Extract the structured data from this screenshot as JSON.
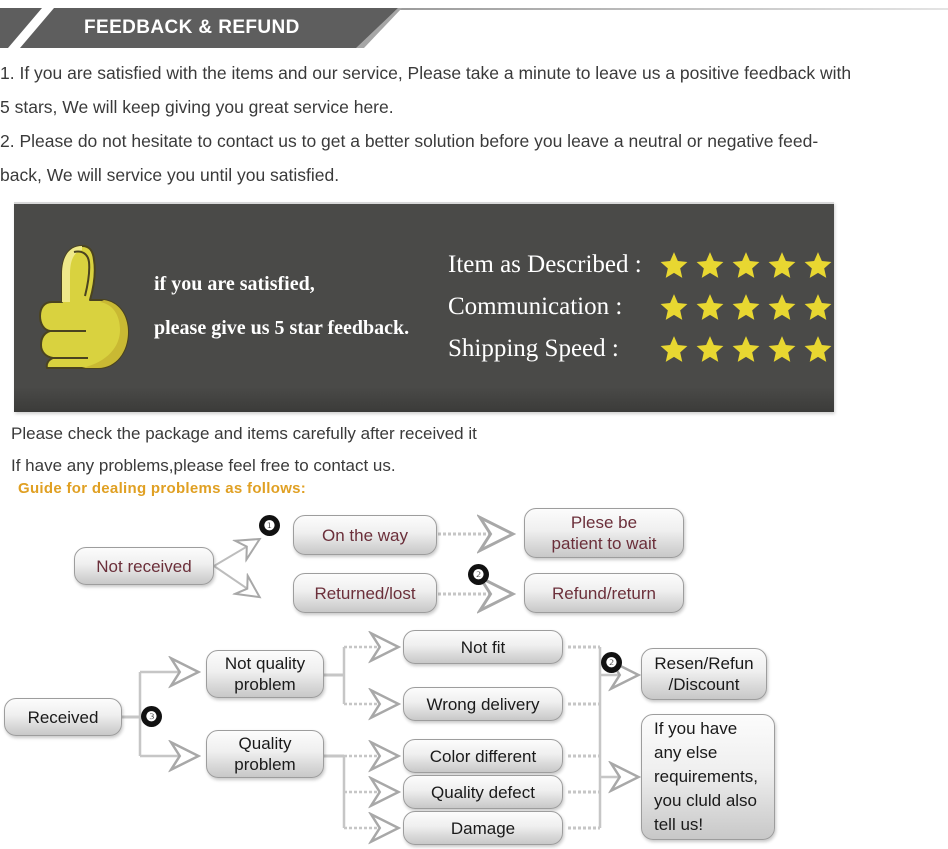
{
  "header": {
    "title": "FEEDBACK & REFUND",
    "banner_color": "#5e5e5e",
    "tip_color": "#a6a6a6"
  },
  "intro": {
    "lines": [
      "1. If you are satisfied with the items and our service, Please take a minute to leave us a positive feedback with",
      "5 stars, We will keep giving you great service here.",
      "2. Please do not hesitate to contact us to get a better solution before you leave a neutral or negative feed-",
      "back, We will service you until you satisfied."
    ]
  },
  "feedback_banner": {
    "background_color": "#4a4a48",
    "thumb_icon": "thumbs-up-icon",
    "left_lines": [
      "if you are satisfied,",
      "please give us 5 star feedback."
    ],
    "star_color": "#e8d731",
    "ratings": [
      {
        "label": "Item as Described :",
        "stars": 5
      },
      {
        "label": "Communication :",
        "stars": 5
      },
      {
        "label": "Shipping Speed :",
        "stars": 5
      }
    ]
  },
  "notes": {
    "lines": [
      "Please check the package and items carefully after received it",
      "If have any problems,please feel free to contact us."
    ],
    "guide_heading": "Guide for dealing problems as follows:",
    "guide_color": "#e0a023"
  },
  "flow_one": {
    "nodes": {
      "not_received": "Not received",
      "on_the_way": "On the way",
      "returned_lost": "Returned/lost",
      "please_wait": "Plese be\npatient to wait",
      "refund_return": "Refund/return"
    },
    "badges": {
      "one": "❶",
      "two": "❷"
    },
    "text_color": "#6b2f3a"
  },
  "flow_two": {
    "nodes": {
      "received": "Received",
      "not_quality_problem": "Not quality\nproblem",
      "quality_problem": "Quality\nproblem",
      "not_fit": "Not fit",
      "wrong_delivery": "Wrong delivery",
      "color_different": "Color different",
      "quality_defect": "Quality defect",
      "damage": "Damage",
      "resend_refund": "Resen/Refun\n/Discount",
      "any_else": "If you have\nany else\nrequirements,\nyou cluld also\ntell us!"
    },
    "badges": {
      "three": "❸",
      "two": "❷"
    },
    "text_color": "#1a1a1a"
  }
}
